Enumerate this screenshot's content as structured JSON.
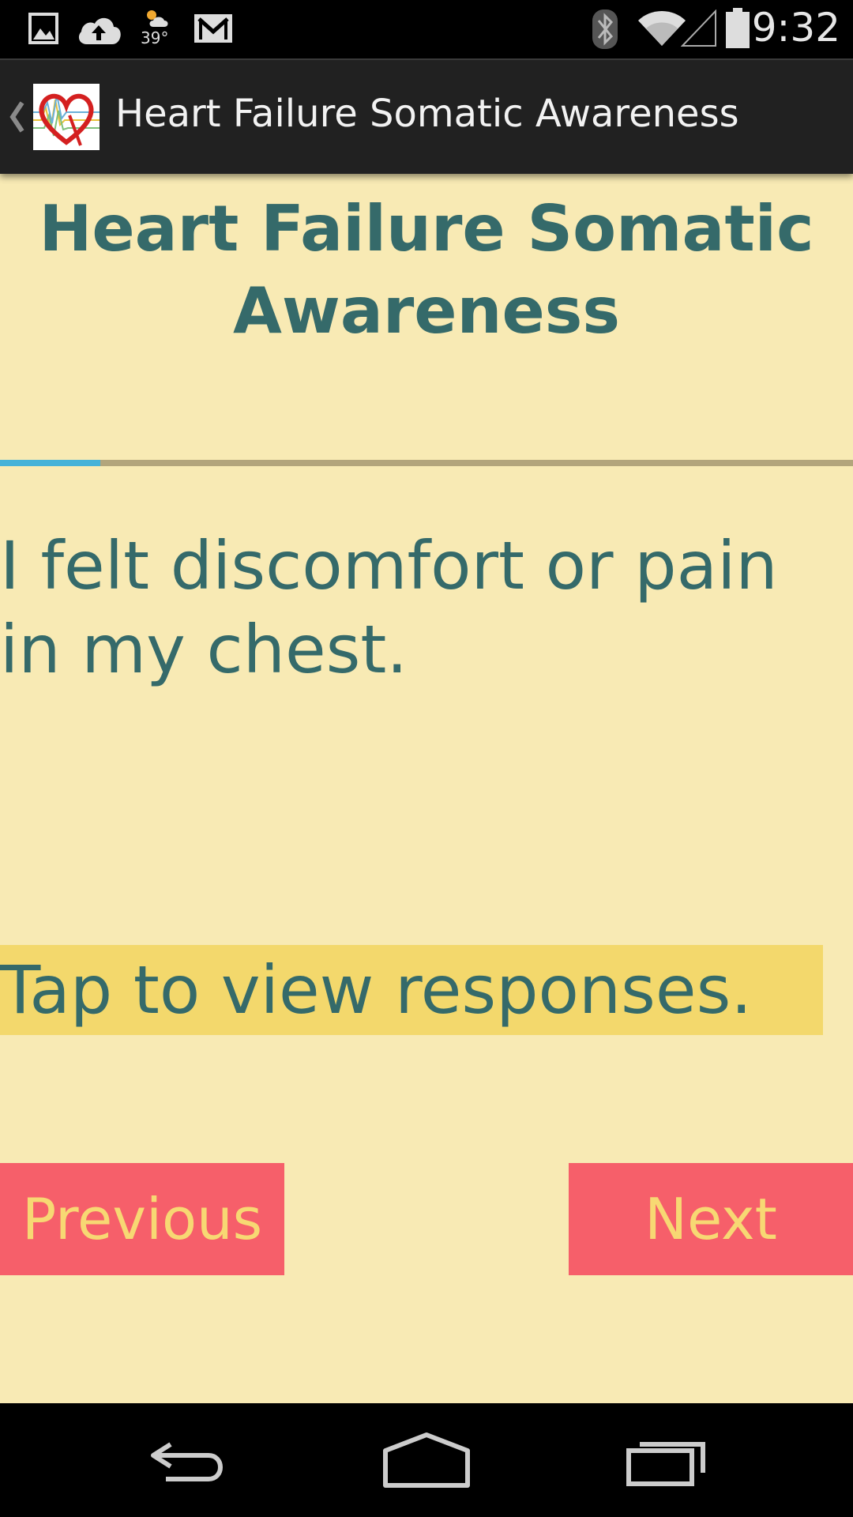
{
  "status_bar": {
    "time": "9:32",
    "temperature": "39°",
    "icons": [
      "image-icon",
      "cloud-upload-icon",
      "weather-icon",
      "gmail-icon",
      "bluetooth-icon",
      "wifi-icon",
      "signal-icon",
      "battery-icon"
    ]
  },
  "action_bar": {
    "title": "Heart Failure Somatic Awareness",
    "icons": [
      "back-caret-icon",
      "app-logo-icon"
    ]
  },
  "content": {
    "title": "Heart Failure Somatic Awareness",
    "progress_fraction": 0.118,
    "question": "I felt discomfort or pain in my chest.",
    "responses_prompt": "Tap to view responses.",
    "previous_label": "Previous",
    "next_label": "Next"
  },
  "navigation_bar": {
    "icons": [
      "back-icon",
      "home-icon",
      "recents-icon"
    ]
  },
  "colors": {
    "background": "#f8eab4",
    "text": "#356a6a",
    "button": "#f65f6a",
    "button_text": "#f7d873",
    "highlight": "#f3d86c",
    "progress": "#45b2d8"
  }
}
